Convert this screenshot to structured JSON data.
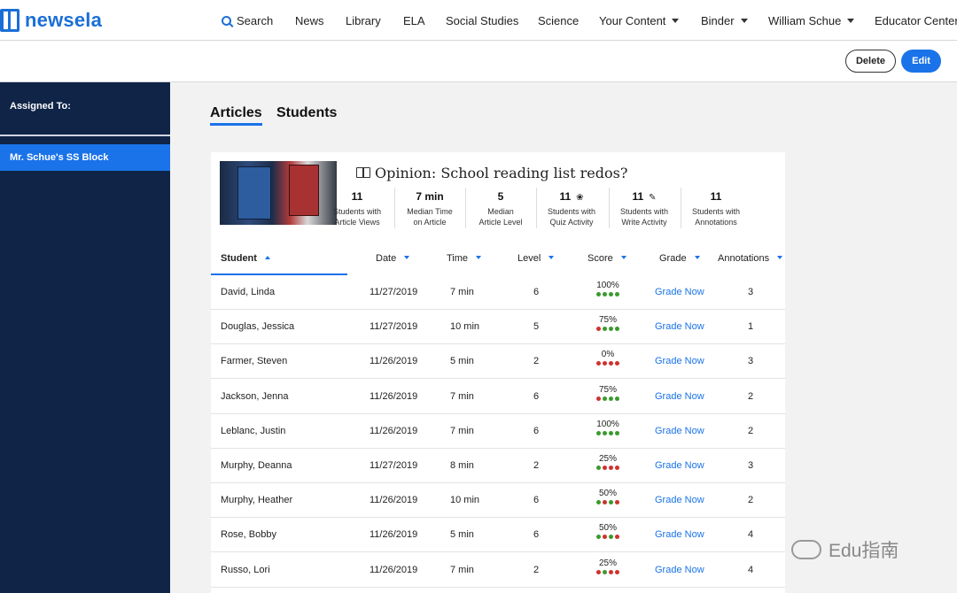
{
  "brand": {
    "name": "newsela",
    "color": "#1a6fd6"
  },
  "nav": {
    "search": "Search",
    "news": "News",
    "library": "Library",
    "ela": "ELA",
    "social_studies": "Social Studies",
    "science": "Science",
    "your_content": "Your Content",
    "binder": "Binder",
    "user": "William Schue",
    "educator_center": "Educator Center"
  },
  "actions": {
    "delete": "Delete",
    "edit": "Edit"
  },
  "sidebar": {
    "heading": "Assigned To:",
    "items": [
      {
        "label": "Mr. Schue's SS Block"
      }
    ]
  },
  "tabs": [
    {
      "label": "Articles",
      "active": true
    },
    {
      "label": "Students",
      "active": false
    }
  ],
  "article": {
    "title": "Opinion: School reading list redos?",
    "stats": [
      {
        "value": "11",
        "label1": "Students with",
        "label2": "Article Views",
        "icon": ""
      },
      {
        "value": "7 min",
        "label1": "Median Time",
        "label2": "on Article",
        "icon": ""
      },
      {
        "value": "5",
        "label1": "Median",
        "label2": "Article Level",
        "icon": ""
      },
      {
        "value": "11",
        "label1": "Students with",
        "label2": "Quiz Activity",
        "icon": "lightbulb-icon"
      },
      {
        "value": "11",
        "label1": "Students with",
        "label2": "Write Activity",
        "icon": "pencil-icon"
      },
      {
        "value": "11",
        "label1": "Students with",
        "label2": "Annotations",
        "icon": ""
      }
    ]
  },
  "table": {
    "headers": {
      "student": "Student",
      "date": "Date",
      "time": "Time",
      "level": "Level",
      "score": "Score",
      "grade": "Grade",
      "annotations": "Annotations"
    },
    "colors": {
      "correct": "#3a9a2e",
      "incorrect": "#d0312d",
      "link": "#1a73e8"
    },
    "rows": [
      {
        "student": "David, Linda",
        "date": "11/27/2019",
        "time": "7 min",
        "level": "6",
        "score": "100%",
        "dots": [
          "g",
          "g",
          "g",
          "g"
        ],
        "grade": "Grade Now",
        "annotations": "3"
      },
      {
        "student": "Douglas, Jessica",
        "date": "11/27/2019",
        "time": "10 min",
        "level": "5",
        "score": "75%",
        "dots": [
          "r",
          "g",
          "g",
          "g"
        ],
        "grade": "Grade Now",
        "annotations": "1"
      },
      {
        "student": "Farmer, Steven",
        "date": "11/26/2019",
        "time": "5 min",
        "level": "2",
        "score": "0%",
        "dots": [
          "r",
          "r",
          "r",
          "r"
        ],
        "grade": "Grade Now",
        "annotations": "3"
      },
      {
        "student": "Jackson, Jenna",
        "date": "11/26/2019",
        "time": "7 min",
        "level": "6",
        "score": "75%",
        "dots": [
          "r",
          "g",
          "g",
          "g"
        ],
        "grade": "Grade Now",
        "annotations": "2"
      },
      {
        "student": "Leblanc, Justin",
        "date": "11/26/2019",
        "time": "7 min",
        "level": "6",
        "score": "100%",
        "dots": [
          "g",
          "g",
          "g",
          "g"
        ],
        "grade": "Grade Now",
        "annotations": "2"
      },
      {
        "student": "Murphy, Deanna",
        "date": "11/27/2019",
        "time": "8 min",
        "level": "2",
        "score": "25%",
        "dots": [
          "g",
          "r",
          "r",
          "r"
        ],
        "grade": "Grade Now",
        "annotations": "3"
      },
      {
        "student": "Murphy, Heather",
        "date": "11/26/2019",
        "time": "10 min",
        "level": "6",
        "score": "50%",
        "dots": [
          "g",
          "r",
          "g",
          "r"
        ],
        "grade": "Grade Now",
        "annotations": "2"
      },
      {
        "student": "Rose, Bobby",
        "date": "11/26/2019",
        "time": "5 min",
        "level": "6",
        "score": "50%",
        "dots": [
          "g",
          "r",
          "g",
          "r"
        ],
        "grade": "Grade Now",
        "annotations": "4"
      },
      {
        "student": "Russo, Lori",
        "date": "11/26/2019",
        "time": "7 min",
        "level": "2",
        "score": "25%",
        "dots": [
          "r",
          "g",
          "r",
          "r"
        ],
        "grade": "Grade Now",
        "annotations": "4"
      }
    ]
  },
  "watermark": "Edu指南"
}
